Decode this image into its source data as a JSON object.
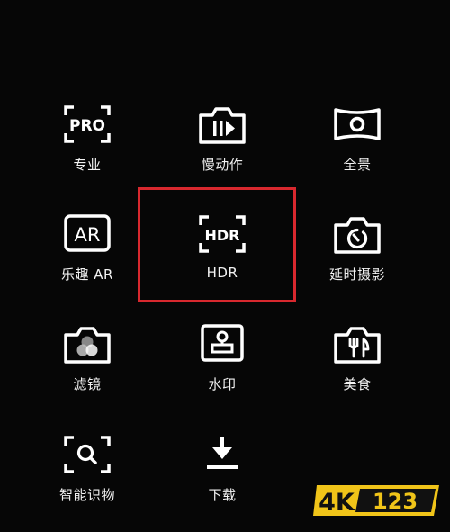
{
  "modes": [
    {
      "label": "专业",
      "icon": "pro-icon",
      "badge": "PRO"
    },
    {
      "label": "慢动作",
      "icon": "slow-motion-icon"
    },
    {
      "label": "全景",
      "icon": "panorama-icon"
    },
    {
      "label": "乐趣 AR",
      "icon": "ar-icon",
      "badge": "AR"
    },
    {
      "label": "HDR",
      "icon": "hdr-icon",
      "badge": "HDR"
    },
    {
      "label": "延时摄影",
      "icon": "time-lapse-icon"
    },
    {
      "label": "滤镜",
      "icon": "filter-icon"
    },
    {
      "label": "水印",
      "icon": "watermark-icon"
    },
    {
      "label": "美食",
      "icon": "food-icon"
    },
    {
      "label": "智能识物",
      "icon": "object-recognition-icon"
    },
    {
      "label": "下载",
      "icon": "download-icon"
    }
  ],
  "highlight": {
    "mode": "HDR",
    "color": "#d8282e"
  },
  "watermark": {
    "text_4k": "4K",
    "text_123": "123",
    "color": "#f0c419"
  }
}
